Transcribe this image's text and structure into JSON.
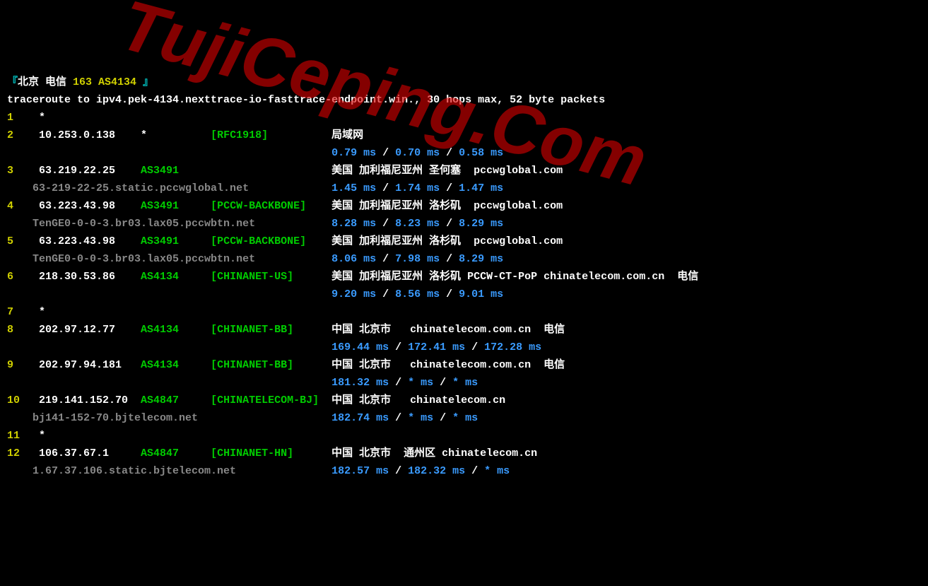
{
  "header": {
    "prefix": "『",
    "city": "北京",
    "isp": "电信",
    "asn": "163 AS4134",
    "suffix": "』"
  },
  "cmd": "traceroute to ipv4.pek-4134.nexttrace-io-fasttrace-endpoint.win., 30 hops max, 52 byte packets",
  "watermark": "TujiCeping.Com",
  "hops": [
    {
      "n": "1",
      "timeout": true
    },
    {
      "n": "2",
      "ip": "10.253.0.138",
      "as": "*",
      "tag": "[RFC1918]",
      "loc": "局域网",
      "t1": "0.79 ms",
      "t2": "0.70 ms",
      "t3": "0.58 ms"
    },
    {
      "n": "3",
      "ip": "63.219.22.25",
      "as": "AS3491",
      "tag": "",
      "loc": "美国 加利福尼亚州 圣何塞  pccwglobal.com",
      "ptr": "63-219-22-25.static.pccwglobal.net",
      "t1": "1.45 ms",
      "t2": "1.74 ms",
      "t3": "1.47 ms"
    },
    {
      "n": "4",
      "ip": "63.223.43.98",
      "as": "AS3491",
      "tag": "[PCCW-BACKBONE]",
      "loc": "美国 加利福尼亚州 洛杉矶  pccwglobal.com",
      "ptr": "TenGE0-0-0-3.br03.lax05.pccwbtn.net",
      "t1": "8.28 ms",
      "t2": "8.23 ms",
      "t3": "8.29 ms"
    },
    {
      "n": "5",
      "ip": "63.223.43.98",
      "as": "AS3491",
      "tag": "[PCCW-BACKBONE]",
      "loc": "美国 加利福尼亚州 洛杉矶  pccwglobal.com",
      "ptr": "TenGE0-0-0-3.br03.lax05.pccwbtn.net",
      "t1": "8.06 ms",
      "t2": "7.98 ms",
      "t3": "8.29 ms"
    },
    {
      "n": "6",
      "ip": "218.30.53.86",
      "as": "AS4134",
      "tag": "[CHINANET-US]",
      "loc_pre": "美国 加利福尼亚州 洛杉矶 ",
      "loc_bold": "PCCW-CT-PoP",
      "loc_post": " chinatelecom.com.cn  电信",
      "t1": "9.20 ms",
      "t2": "8.56 ms",
      "t3": "9.01 ms"
    },
    {
      "n": "7",
      "timeout": true
    },
    {
      "n": "8",
      "ip": "202.97.12.77",
      "as": "AS4134",
      "tag": "[CHINANET-BB]",
      "loc": "中国 北京市   chinatelecom.com.cn  电信",
      "t1": "169.44 ms",
      "t2": "172.41 ms",
      "t3": "172.28 ms"
    },
    {
      "n": "9",
      "ip": "202.97.94.181",
      "as": "AS4134",
      "tag": "[CHINANET-BB]",
      "loc": "中国 北京市   chinatelecom.com.cn  电信",
      "t1": "181.32 ms",
      "t2": "* ms",
      "t3": "* ms"
    },
    {
      "n": "10",
      "ip": "219.141.152.70",
      "as": "AS4847",
      "tag": "[CHINATELECOM-BJ]",
      "loc": "中国 北京市   chinatelecom.cn",
      "ptr": "bj141-152-70.bjtelecom.net",
      "t1": "182.74 ms",
      "t2": "* ms",
      "t3": "* ms"
    },
    {
      "n": "11",
      "timeout": true
    },
    {
      "n": "12",
      "ip": "106.37.67.1",
      "as": "AS4847",
      "tag": "[CHINANET-HN]",
      "loc": "中国 北京市  通州区 chinatelecom.cn",
      "ptr": "1.67.37.106.static.bjtelecom.net",
      "t1": "182.57 ms",
      "t2": "182.32 ms",
      "t3": "* ms"
    }
  ]
}
